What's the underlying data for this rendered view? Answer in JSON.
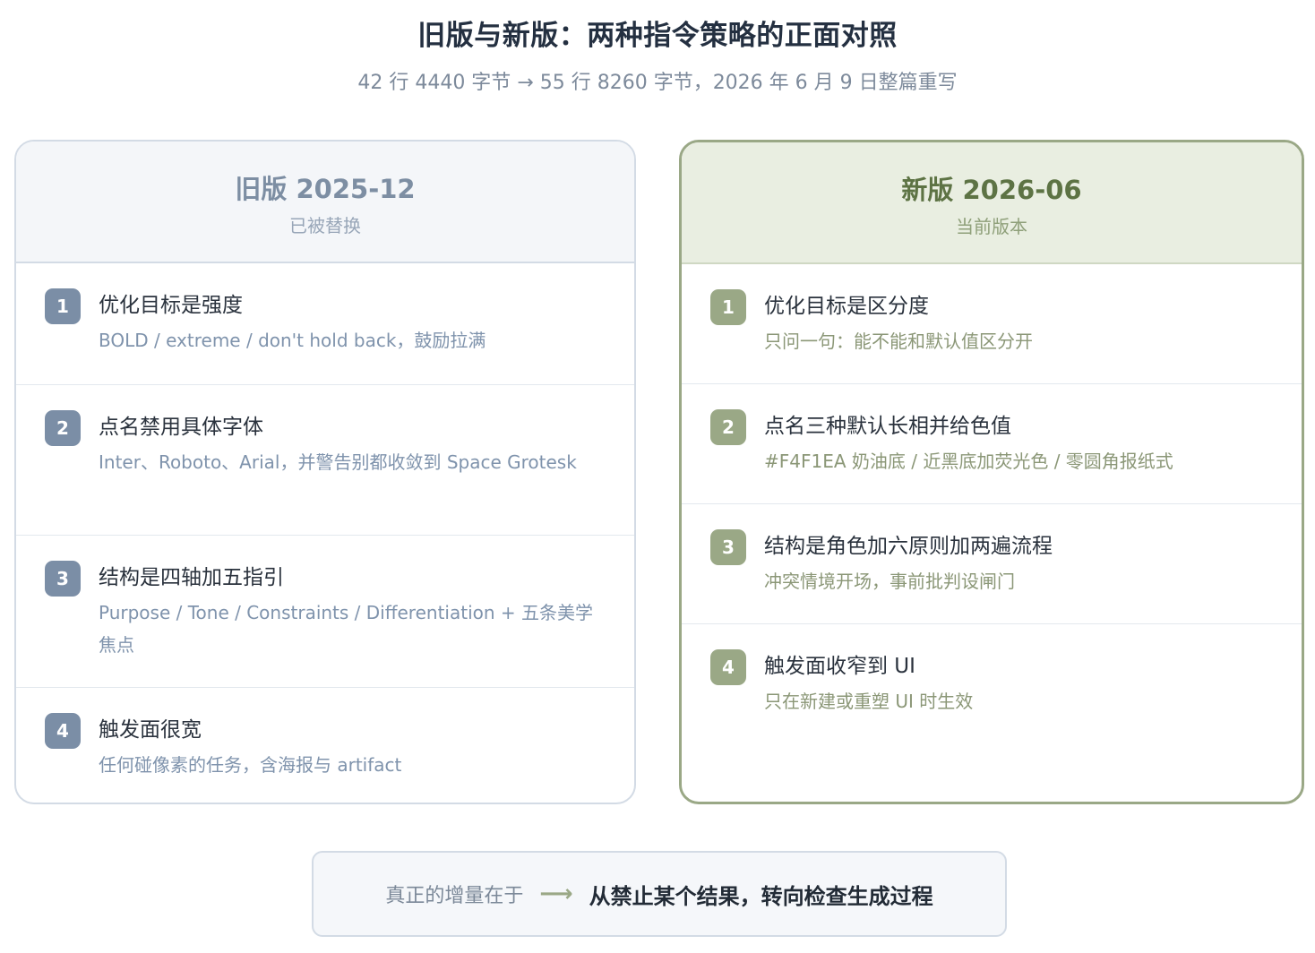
{
  "title": "旧版与新版：两种指令策略的正面对照",
  "subtitle": "42 行 4440 字节 → 55 行 8260 字节，2026 年 6 月 9 日整篇重写",
  "old": {
    "name": "旧版 2025-12",
    "status": "已被替换",
    "items": [
      {
        "num": "1",
        "title": "优化目标是强度",
        "desc": "BOLD / extreme / don't hold back，鼓励拉满"
      },
      {
        "num": "2",
        "title": "点名禁用具体字体",
        "desc": "Inter、Roboto、Arial，并警告别都收敛到 Space Grotesk"
      },
      {
        "num": "3",
        "title": "结构是四轴加五指引",
        "desc": "Purpose / Tone / Constraints / Differentiation + 五条美学焦点"
      },
      {
        "num": "4",
        "title": "触发面很宽",
        "desc": "任何碰像素的任务，含海报与 artifact"
      }
    ]
  },
  "new": {
    "name": "新版 2026-06",
    "status": "当前版本",
    "items": [
      {
        "num": "1",
        "title": "优化目标是区分度",
        "desc": "只问一句：能不能和默认值区分开"
      },
      {
        "num": "2",
        "title": "点名三种默认长相并给色值",
        "desc": "#F4F1EA 奶油底 / 近黑底加荧光色 / 零圆角报纸式"
      },
      {
        "num": "3",
        "title": "结构是角色加六原则加两遍流程",
        "desc": "冲突情境开场，事前批判设闸门"
      },
      {
        "num": "4",
        "title": "触发面收窄到 UI",
        "desc": "只在新建或重塑 UI 时生效"
      }
    ]
  },
  "footer": {
    "lead": "真正的增量在于",
    "arrow": "⟶",
    "main": "从禁止某个结果，转向检查生成过程"
  },
  "colors": {
    "old_accent": "#7b8ea6",
    "new_accent": "#9aa886",
    "new_title": "#5d7344"
  }
}
